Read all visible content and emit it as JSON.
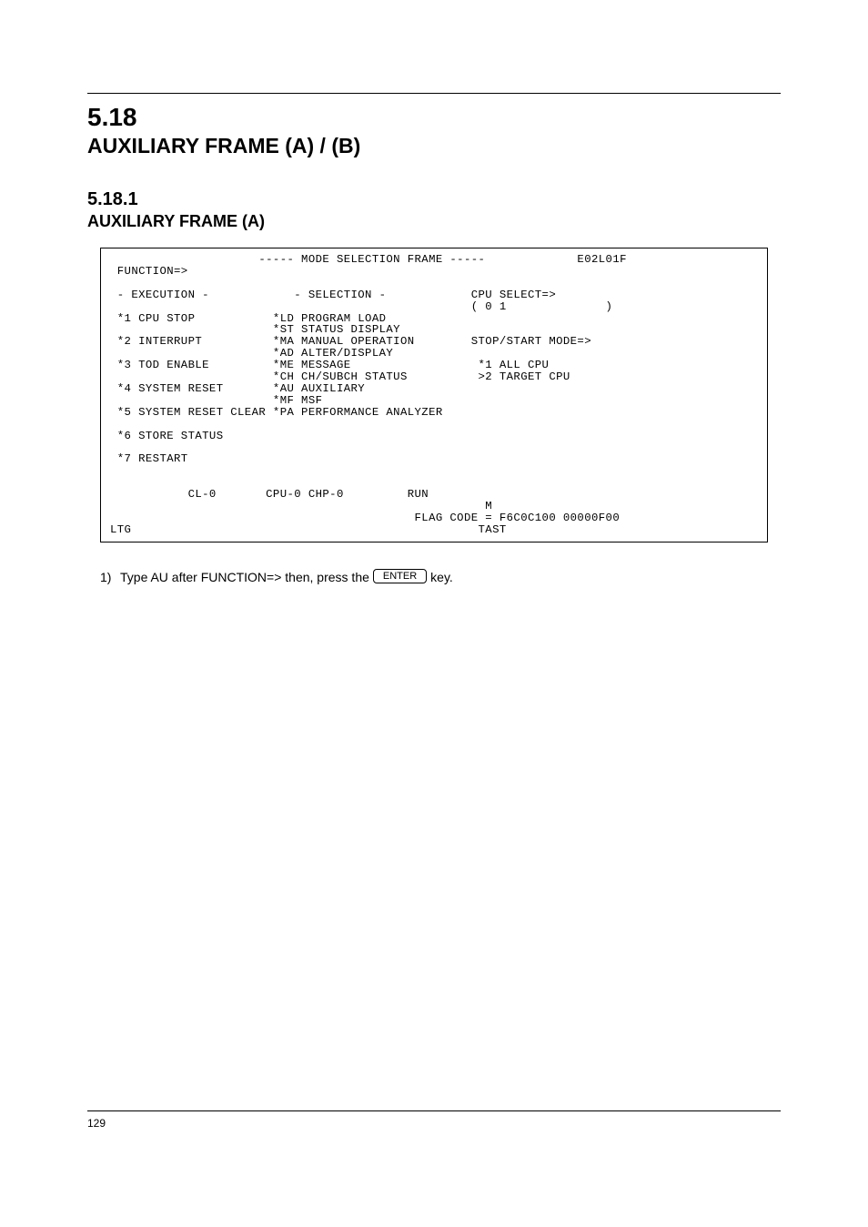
{
  "chapter": {
    "number": "5.18",
    "title": "AUXILIARY FRAME (A) / (B)"
  },
  "section": {
    "number": "5.18.1",
    "title": "AUXILIARY FRAME (A)"
  },
  "terminal": {
    "title_bar": "                     ----- MODE SELECTION FRAME -----             E02L01F",
    "function_label": " FUNCTION=>",
    "blank": "",
    "row_headers": " - EXECUTION -            - SELECTION -            CPU SELECT=>",
    "cpu_select_vals": "                                                   ( 0 1              )",
    "r1": " *1 CPU STOP           *LD PROGRAM LOAD",
    "r1b": "                       *ST STATUS DISPLAY",
    "r2": " *2 INTERRUPT          *MA MANUAL OPERATION        STOP/START MODE=>",
    "r2b": "                       *AD ALTER/DISPLAY",
    "r3": " *3 TOD ENABLE         *ME MESSAGE                  *1 ALL CPU",
    "r3b": "                       *CH CH/SUBCH STATUS          >2 TARGET CPU",
    "r4": " *4 SYSTEM RESET       *AU AUXILIARY",
    "r4b": "                       *MF MSF",
    "r5": " *5 SYSTEM RESET CLEAR *PA PERFORMANCE ANALYZER",
    "r6": " *6 STORE STATUS",
    "r7": " *7 RESTART",
    "status": "           CL-0       CPU-0 CHP-0         RUN",
    "flag_m": "                                                     M",
    "flag": "                                           FLAG CODE = F6C0C100 00000F00",
    "ltg": "LTG                                                 TAST"
  },
  "instruction": {
    "step": "1)",
    "text_before": "Type AU after FUNCTION=> then, press the ",
    "key": "ENTER",
    "text_after": " key."
  },
  "footer": {
    "left": "129",
    "right": ""
  }
}
